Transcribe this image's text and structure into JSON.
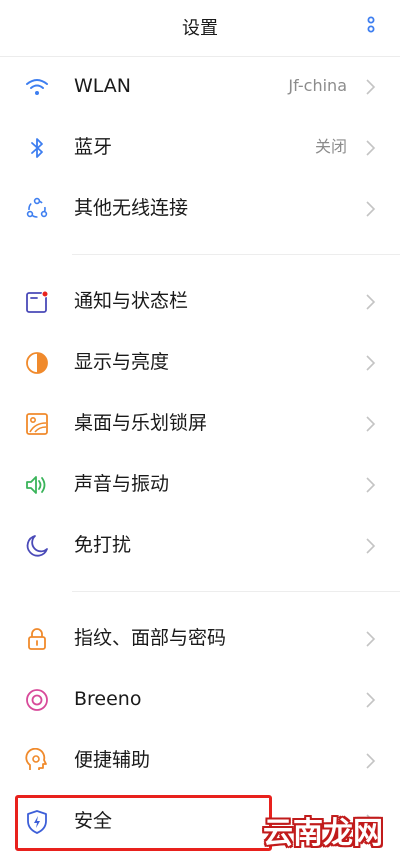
{
  "header": {
    "title": "设置"
  },
  "groups": [
    {
      "items": [
        {
          "label": "WLAN",
          "value": "Jf-china",
          "icon": "wifi-icon"
        },
        {
          "label": "蓝牙",
          "value": "关闭",
          "icon": "bluetooth-icon"
        },
        {
          "label": "其他无线连接",
          "value": "",
          "icon": "wireless-connections-icon"
        }
      ]
    },
    {
      "items": [
        {
          "label": "通知与状态栏",
          "value": "",
          "icon": "notification-icon"
        },
        {
          "label": "显示与亮度",
          "value": "",
          "icon": "brightness-icon"
        },
        {
          "label": "桌面与乐划锁屏",
          "value": "",
          "icon": "wallpaper-icon"
        },
        {
          "label": "声音与振动",
          "value": "",
          "icon": "speaker-icon"
        },
        {
          "label": "免打扰",
          "value": "",
          "icon": "moon-icon"
        }
      ]
    },
    {
      "items": [
        {
          "label": "指纹、面部与密码",
          "value": "",
          "icon": "lock-icon"
        },
        {
          "label": "Breeno",
          "value": "",
          "icon": "breeno-icon"
        },
        {
          "label": "便捷辅助",
          "value": "",
          "icon": "assist-icon"
        },
        {
          "label": "安全",
          "value": "",
          "icon": "shield-icon"
        }
      ]
    }
  ],
  "watermark": {
    "text": "云南龙网"
  },
  "colors": {
    "highlight": "#e8211d",
    "accent_blue": "#3d7ef0",
    "accent_orange": "#f08a2c",
    "accent_green": "#3ab45a",
    "accent_purple": "#4a4ab8",
    "accent_pink": "#d84a9a"
  }
}
